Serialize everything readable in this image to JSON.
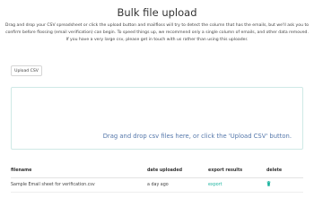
{
  "page": {
    "title": "Bulk file upload",
    "description": "Drag and drop your CSV spreadsheet or click the upload button and mailfloss will try to detect the column that has the emails, but we'll ask you to confirm before flossing (email verification) can begin. To speed things up, we recommend only a single column of emails, and other data removed. If you have a very large csv, please get in touch with us rather than using this uploader."
  },
  "upload": {
    "button_label": "Upload CSV"
  },
  "dropzone": {
    "text": "Drag and drop csv files here, or click the 'Upload CSV' button."
  },
  "table": {
    "headers": [
      "filename",
      "date uploaded",
      "export results",
      "delete"
    ],
    "rows": [
      {
        "filename": "Sample Email sheet for verification.csv",
        "date": "a day ago",
        "export": "export",
        "delete_icon": "trash-icon"
      }
    ]
  },
  "colors": {
    "accent": "#1ab39f",
    "dropzone_border": "#cfe9e6",
    "dropzone_text": "#5577aa"
  }
}
